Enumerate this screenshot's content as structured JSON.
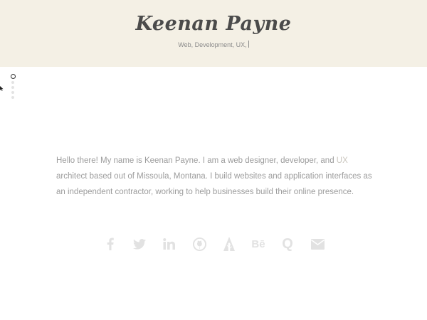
{
  "header": {
    "title": "Keenan Payne",
    "tagline": "Web, Development, UX,"
  },
  "nav": {
    "dots": [
      "section-1",
      "section-2",
      "section-3",
      "section-4",
      "section-5"
    ],
    "active_index": 0
  },
  "bio": {
    "text_before": "Hello there! My name is Keenan Payne. I am a web designer, developer, and ",
    "link": "UX",
    "text_after": " architect based out of Missoula, Montana. I build websites and application interfaces as an independent contractor, working to help businesses build their online presence."
  },
  "social": {
    "icons": [
      "facebook-icon",
      "twitter-icon",
      "linkedin-icon",
      "github-icon",
      "forrst-icon",
      "behance-icon",
      "quora-icon",
      "email-icon"
    ],
    "behance_label": "Bē",
    "quora_label": "Q"
  },
  "colors": {
    "header_bg": "#f4f0e5",
    "title": "#4b4b4b",
    "body_text": "#9c9c9c",
    "icon": "#e2e2e2"
  }
}
